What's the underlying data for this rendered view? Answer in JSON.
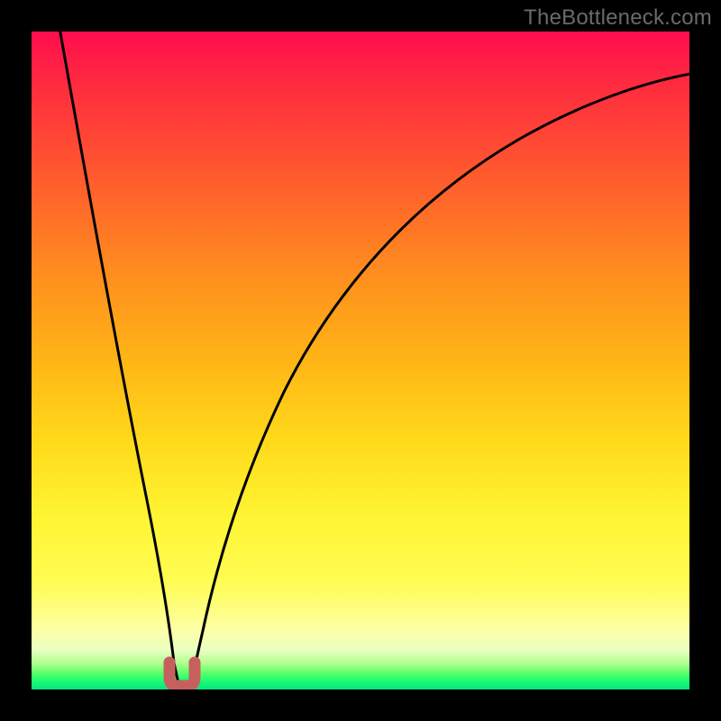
{
  "chart_data": {
    "type": "line",
    "description": "Bottleneck percentage vs relative hardware balance; two black curves descend steeply to a narrow minimum near x≈0.22 then the right curve rises slowly toward the upper-right. A short red/pink U-shaped marker sits at the trough.",
    "x": [
      0.0,
      0.05,
      0.1,
      0.15,
      0.18,
      0.2,
      0.21,
      0.215,
      0.22,
      0.225,
      0.23,
      0.24,
      0.26,
      0.3,
      0.35,
      0.4,
      0.45,
      0.5,
      0.6,
      0.7,
      0.8,
      0.9,
      1.0
    ],
    "series": [
      {
        "name": "left-branch",
        "values": [
          100,
          78,
          55,
          33,
          20,
          11,
          6.5,
          4,
          2,
          0.5,
          null,
          null,
          null,
          null,
          null,
          null,
          null,
          null,
          null,
          null,
          null,
          null,
          null
        ]
      },
      {
        "name": "right-branch",
        "values": [
          null,
          null,
          null,
          null,
          null,
          null,
          null,
          null,
          2,
          3,
          5,
          9,
          16,
          28,
          39,
          48,
          55,
          61,
          71,
          78,
          83,
          87,
          90
        ]
      }
    ],
    "marker": {
      "x": 0.215,
      "y": 1.5,
      "shape": "U",
      "color": "#c6605f"
    },
    "xlim": [
      0,
      1
    ],
    "ylim": [
      0,
      100
    ],
    "xlabel": "",
    "ylabel": "",
    "title": "",
    "grid": false,
    "legend": false,
    "background_gradient": [
      "#ff0d4f",
      "#ffd91a",
      "#04e57e"
    ]
  },
  "watermark": "TheBottleneck.com"
}
